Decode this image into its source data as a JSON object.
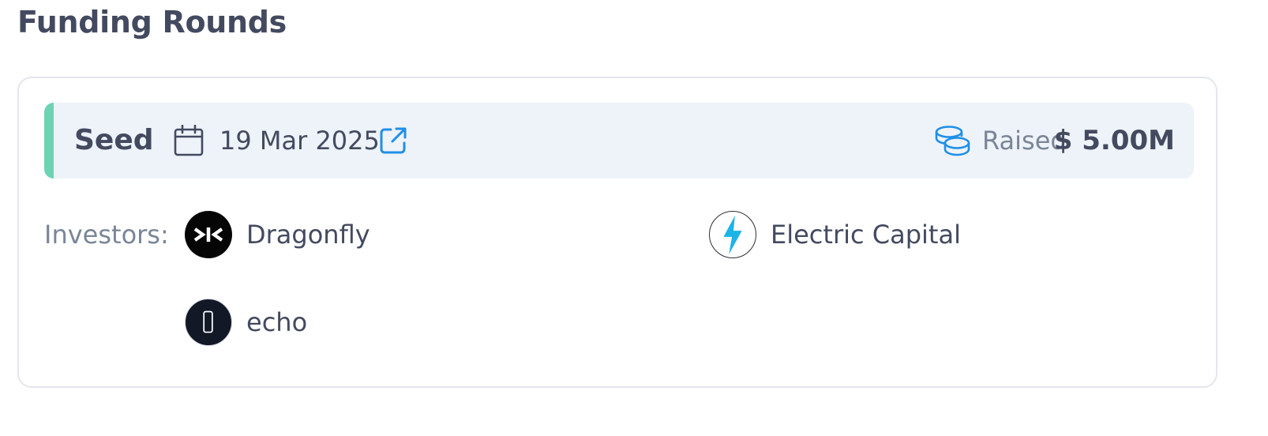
{
  "section": {
    "title": "Funding Rounds"
  },
  "round": {
    "name": "Seed",
    "date": "19 Mar 2025",
    "raised_label": "Raised",
    "raised_amount": "$ 5.00M",
    "accent_color": "#6fd2b3",
    "icon_color": "#1f8fe8"
  },
  "investors": {
    "label": "Investors:",
    "items": [
      {
        "name": "Dragonfly",
        "icon": "dragonfly-logo"
      },
      {
        "name": "Electric Capital",
        "icon": "electric-capital-logo"
      },
      {
        "name": "echo",
        "icon": "echo-logo"
      }
    ]
  }
}
